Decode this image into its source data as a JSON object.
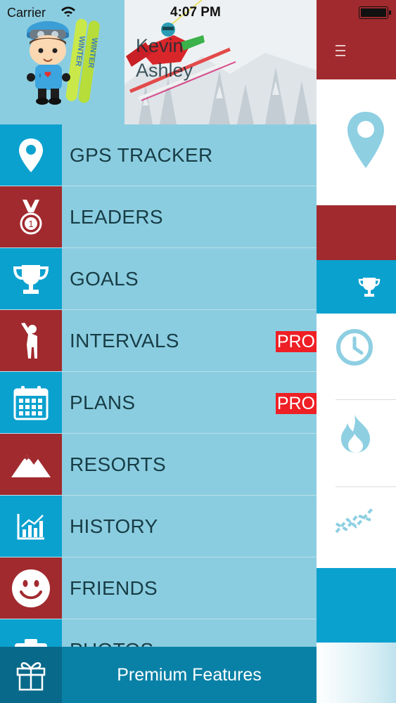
{
  "status_bar": {
    "carrier": "Carrier",
    "time": "4:07 PM"
  },
  "profile": {
    "name": "Kevin\nAshley"
  },
  "menu": {
    "items": [
      {
        "label": "GPS TRACKER",
        "icon": "map-pin-icon",
        "icon_bg": "#0ba1cf"
      },
      {
        "label": "LEADERS",
        "icon": "medal-icon",
        "icon_bg": "#a12a2e"
      },
      {
        "label": "GOALS",
        "icon": "trophy-icon",
        "icon_bg": "#0ba1cf"
      },
      {
        "label": "INTERVALS",
        "icon": "person-icon",
        "icon_bg": "#a12a2e",
        "badge": "PRO"
      },
      {
        "label": "PLANS",
        "icon": "calendar-icon",
        "icon_bg": "#0ba1cf",
        "badge": "PRO"
      },
      {
        "label": "RESORTS",
        "icon": "mountain-icon",
        "icon_bg": "#a12a2e"
      },
      {
        "label": "HISTORY",
        "icon": "chart-icon",
        "icon_bg": "#0ba1cf"
      },
      {
        "label": "FRIENDS",
        "icon": "smiley-icon",
        "icon_bg": "#a12a2e"
      },
      {
        "label": "PHOTOS",
        "icon": "camera-icon",
        "icon_bg": "#0ba1cf"
      }
    ]
  },
  "footer": {
    "label": "Premium Features",
    "icon": "gift-icon"
  },
  "colors": {
    "drawer_bg": "#8bcde0",
    "accent_blue": "#0ba1cf",
    "accent_red": "#a12a2e",
    "pro_badge": "#ee1f25",
    "footer_bg": "#0981a6"
  }
}
